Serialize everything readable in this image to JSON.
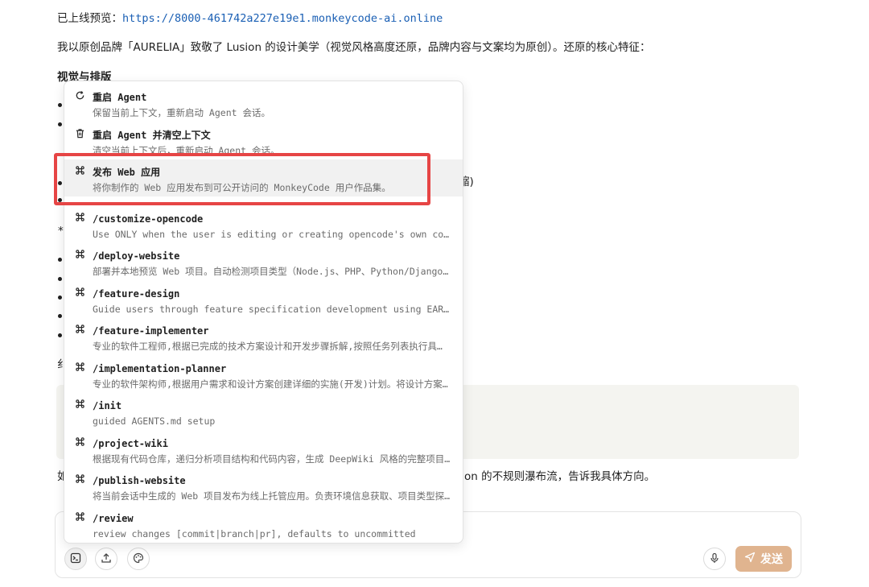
{
  "chat": {
    "preview_label": "已上线预览：",
    "preview_url": "https://8000-461742a227e19e1.monkeycode-ai.online",
    "intro": "我以原创品牌「AURELIA」致敬了 Lusion 的设计美学（视觉风格高度还原，品牌内容与文案均为原创）。还原的核心特征：",
    "section_heading": "视觉与排版",
    "frag_shrink": "缩)",
    "frag_star": "*",
    "frag_fine": "纟",
    "frag_ru": "如",
    "tail_text": "on 的不规则瀑布流，告诉我具体方向。"
  },
  "popup": {
    "items": [
      {
        "icon": "refresh-icon",
        "title": "重启 Agent",
        "desc": "保留当前上下文，重新启动 Agent 会话。"
      },
      {
        "icon": "trash-icon",
        "title": "重启 Agent 并清空上下文",
        "desc": "清空当前上下文后，重新启动 Agent 会话。"
      },
      {
        "icon": "command-icon",
        "title": "发布 Web 应用",
        "desc": "将你制作的 Web 应用发布到可公开访问的 MonkeyCode 用户作品集。"
      },
      {
        "icon": "command-icon",
        "title": "/customize-opencode",
        "desc": "Use ONLY when the user is editing or creating opencode's own co…"
      },
      {
        "icon": "command-icon",
        "title": "/deploy-website",
        "desc": "部署并本地预览 Web 项目。自动检测项目类型（Node.js、PHP、Python/Django…"
      },
      {
        "icon": "command-icon",
        "title": "/feature-design",
        "desc": "Guide users through feature specification development using EAR…"
      },
      {
        "icon": "command-icon",
        "title": "/feature-implementer",
        "desc": "专业的软件工程师,根据已完成的技术方案设计和开发步骤拆解,按照任务列表执行具…"
      },
      {
        "icon": "command-icon",
        "title": "/implementation-planner",
        "desc": "专业的软件架构师,根据用户需求和设计方案创建详细的实施(开发)计划。将设计方案…"
      },
      {
        "icon": "command-icon",
        "title": "/init",
        "desc": "guided AGENTS.md setup"
      },
      {
        "icon": "command-icon",
        "title": "/project-wiki",
        "desc": "根据现有代码仓库，递归分析项目结构和代码内容，生成 DeepWiki 风格的完整项目…"
      },
      {
        "icon": "command-icon",
        "title": "/publish-website",
        "desc": "将当前会话中生成的 Web 项目发布为线上托管应用。负责环境信息获取、项目类型探…"
      },
      {
        "icon": "command-icon",
        "title": "/review",
        "desc": "review changes [commit|branch|pr], defaults to uncommitted"
      }
    ]
  },
  "composer": {
    "send_label": "发送",
    "tools": [
      "terminal-icon",
      "upload-icon",
      "palette-icon"
    ],
    "mic_icon": "microphone-icon",
    "send_icon": "send-icon"
  },
  "colors": {
    "link": "#1a5fb4",
    "send_button": "#e0b48f",
    "highlight_border": "#e64545",
    "selected_row": "#f1f1f1"
  }
}
